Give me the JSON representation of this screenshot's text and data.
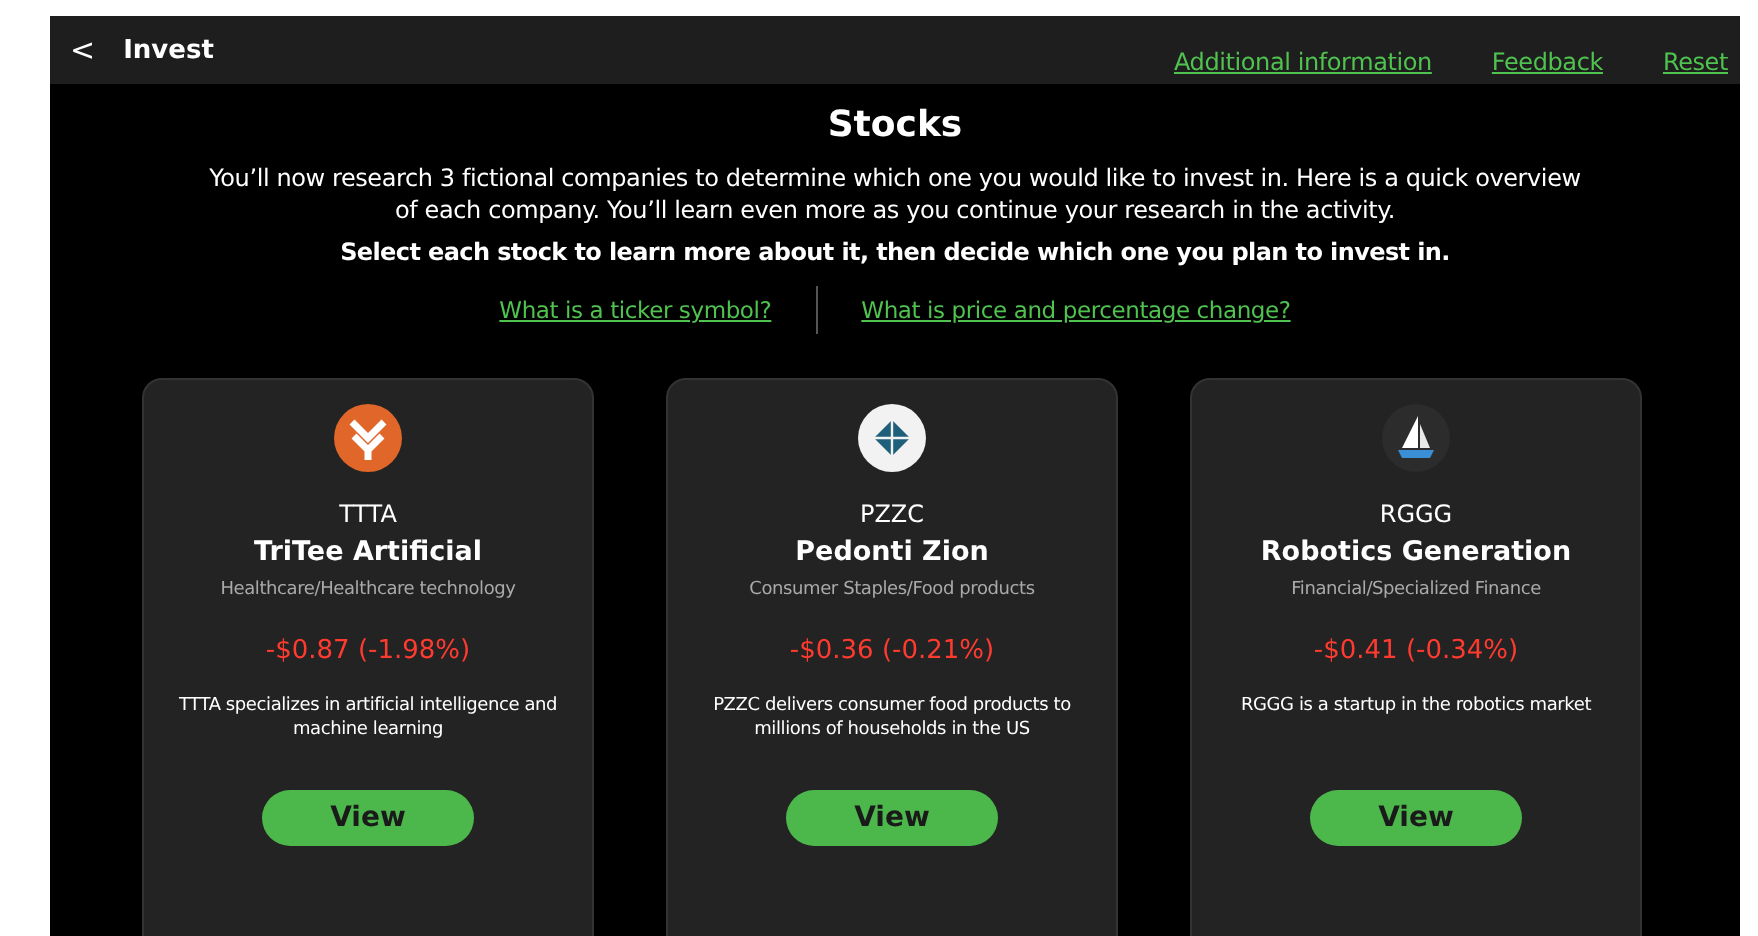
{
  "header": {
    "back": "<",
    "title": "Invest",
    "links": [
      "Additional information",
      "Feedback",
      "Reset"
    ]
  },
  "title": "Stocks",
  "intro": "You’ll now research 3 fictional companies to determine which one you would like to invest in. Here is a quick overview of each company. You’ll learn even more as you continue your research in the activity.",
  "instruction": "Select each stock to learn more about it, then decide which one you plan to invest in.",
  "help_links": [
    "What is a ticker symbol?",
    "What is price and percentage change?"
  ],
  "stocks": [
    {
      "kind": "chevron",
      "ticker": "TTTA",
      "name": "TriTee Artificial",
      "sector": "Healthcare/Healthcare technology",
      "change": "-$0.87 (-1.98%)",
      "description": "TTTA specializes in artificial intelligence and machine learning",
      "button": "View"
    },
    {
      "kind": "diamond",
      "ticker": "PZZC",
      "name": "Pedonti Zion",
      "sector": "Consumer Staples/Food products",
      "change": "-$0.36 (-0.21%)",
      "description": "PZZC delivers consumer food products to millions of households in the US",
      "button": "View"
    },
    {
      "kind": "sailboat",
      "ticker": "RGGG",
      "name": "Robotics Generation",
      "sector": "Financial/Specialized Finance",
      "change": "-$0.41 (-0.34%)",
      "description": "RGGG is a startup in the robotics market",
      "button": "View"
    }
  ]
}
